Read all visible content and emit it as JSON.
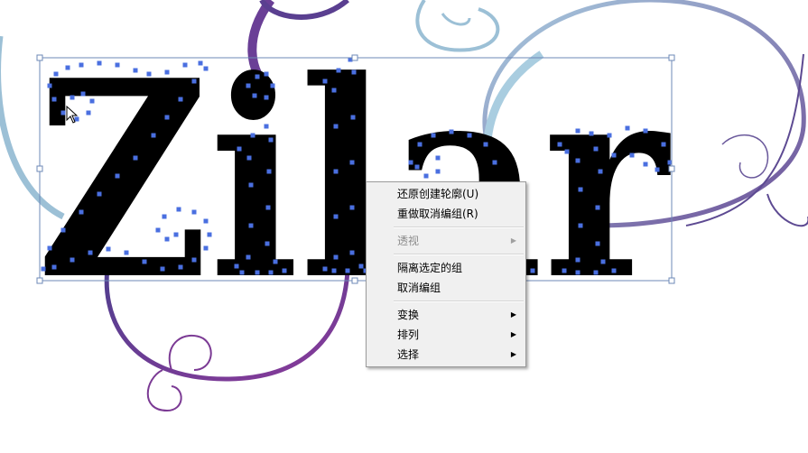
{
  "canvas": {
    "artwork_text": "Zilar",
    "letters": [
      "Z",
      "i",
      "l",
      "a",
      "r"
    ],
    "colors": {
      "glyph_fill": "#000000",
      "anchor_points": "#4a6fe0",
      "selection_box": "#6d88b7",
      "swirl_purple": "#7b3a94",
      "swirl_blue": "#9cc0d6"
    }
  },
  "context_menu": {
    "items": [
      {
        "label": "还原创建轮廓(U)",
        "disabled": false,
        "submenu": false
      },
      {
        "label": "重做取消编组(R)",
        "disabled": false,
        "submenu": false
      },
      {
        "separator": true
      },
      {
        "label": "透视",
        "disabled": true,
        "submenu": true
      },
      {
        "separator": true
      },
      {
        "label": "隔离选定的组",
        "disabled": false,
        "submenu": false
      },
      {
        "label": "取消编组",
        "disabled": false,
        "submenu": false
      },
      {
        "separator": true
      },
      {
        "label": "变换",
        "disabled": false,
        "submenu": true
      },
      {
        "label": "排列",
        "disabled": false,
        "submenu": true
      },
      {
        "label": "选择",
        "disabled": false,
        "submenu": true
      }
    ],
    "arrow_glyph": "▶"
  }
}
